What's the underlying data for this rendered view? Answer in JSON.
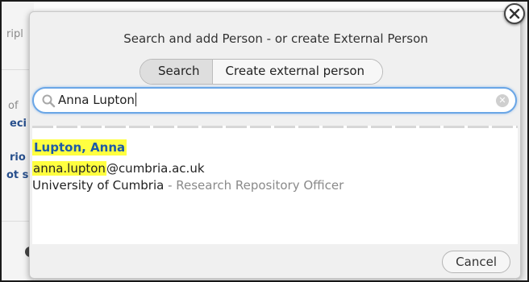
{
  "background": {
    "fragments": [
      "ripl",
      "of",
      "eci",
      "rio",
      "ot s"
    ]
  },
  "dialog": {
    "title": "Search and add Person - or create External Person",
    "tabs": [
      {
        "label": "Search",
        "active": true
      },
      {
        "label": "Create external person",
        "active": false
      }
    ],
    "search": {
      "value": "Anna Lupton",
      "icon": "search-icon"
    },
    "results": [
      {
        "name": "Lupton, Anna",
        "email_highlight": "anna.lupton",
        "email_rest": "@cumbria.ac.uk",
        "organisation": "University of Cumbria",
        "role_separator": " - ",
        "role": "Research Repository Officer"
      }
    ],
    "cancel_label": "Cancel"
  },
  "colors": {
    "highlight": "#ffff40",
    "name_link": "#1d5aa8",
    "focus_ring": "#6aa6e6"
  }
}
